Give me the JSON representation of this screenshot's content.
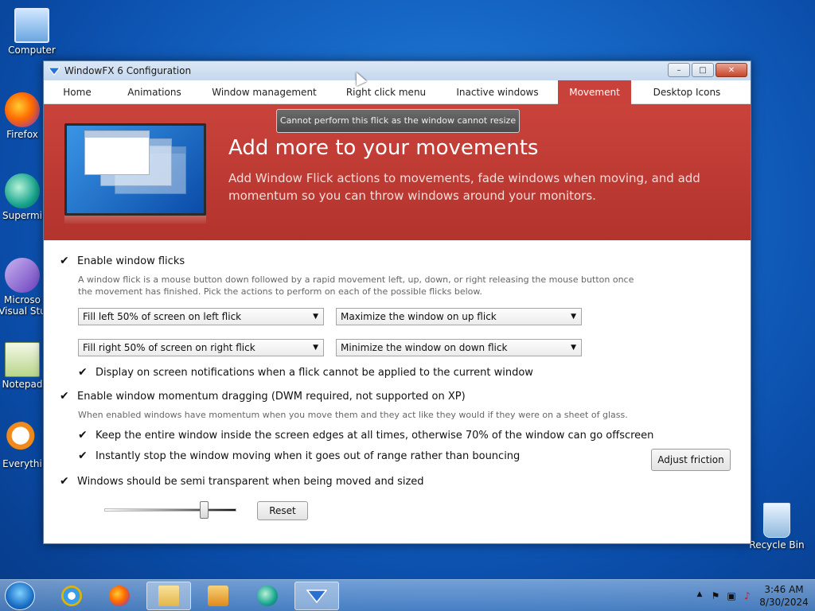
{
  "desktop": {
    "icons": [
      {
        "label": "Computer"
      },
      {
        "label": "Firefox"
      },
      {
        "label": "Supermi"
      },
      {
        "label": "Microso Visual Stu"
      },
      {
        "label": "Notepad"
      },
      {
        "label": "Everythi"
      },
      {
        "label": "Recycle Bin"
      }
    ]
  },
  "window": {
    "title": "WindowFX 6 Configuration",
    "controls": {
      "minimize": "–",
      "maximize": "□",
      "close": "✕"
    }
  },
  "tabs": [
    {
      "label": "Home"
    },
    {
      "label": "Animations"
    },
    {
      "label": "Window management"
    },
    {
      "label": "Right click menu"
    },
    {
      "label": "Inactive windows"
    },
    {
      "label": "Movement"
    },
    {
      "label": "Desktop Icons"
    }
  ],
  "banner": {
    "toast": "Cannot perform this flick as the window cannot resize",
    "title": "Add more to your movements",
    "subtitle": "Add Window Flick actions to movements, fade windows when moving, and add momentum so you can throw windows around your monitors."
  },
  "flicks": {
    "enable_label": "Enable window flicks",
    "description": "A window flick is a mouse button down followed by a rapid movement left, up, down, or right releasing the mouse button once the movement has finished.  Pick the actions to perform on each of the possible flicks below.",
    "left": "Fill left 50% of screen on left flick",
    "up": "Maximize the window on up flick",
    "right": "Fill right 50% of screen on right flick",
    "down": "Minimize the window on down flick",
    "notify_label": "Display on screen notifications when a flick cannot be applied to the current window"
  },
  "momentum": {
    "enable_label": "Enable window momentum dragging (DWM required, not supported on XP)",
    "description": "When enabled windows have momentum when you move them and they act like they would if they were on a sheet of glass.",
    "keep_label": "Keep the entire window inside the screen edges at all times, otherwise 70% of the window can go offscreen",
    "stop_label": "Instantly stop the window moving when it goes out of range rather than bouncing",
    "friction_button": "Adjust friction"
  },
  "transparency": {
    "label": "Windows should be semi transparent when being moved and sized",
    "reset_button": "Reset"
  },
  "checkmark": "✔",
  "dropdown_arrow": "▼",
  "taskbar": {
    "time": "3:46 AM",
    "date": "8/30/2024",
    "tray_up": "▲",
    "tray_flag": "⚑",
    "tray_net": "▣",
    "tray_sound": "♪"
  }
}
